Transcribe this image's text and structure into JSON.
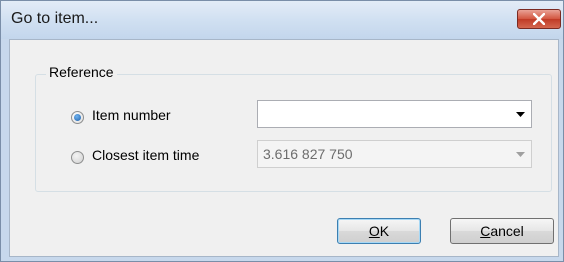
{
  "window": {
    "title": "Go to item...",
    "close_label": "close"
  },
  "group": {
    "legend": "Reference"
  },
  "options": [
    {
      "label": "Item number",
      "checked": true,
      "value": "",
      "enabled": true
    },
    {
      "label": "Closest item time",
      "checked": false,
      "value": "3.616 827 750",
      "enabled": false
    }
  ],
  "buttons": {
    "ok": {
      "accel": "O",
      "rest": "K"
    },
    "cancel": {
      "accel": "C",
      "rest": "ancel"
    }
  },
  "colors": {
    "titlebar": "#cfdff1",
    "close_button": "#c03a26",
    "client_background": "#f0f0f0"
  },
  "icons": [
    "close-icon",
    "chevron-down-icon"
  ]
}
